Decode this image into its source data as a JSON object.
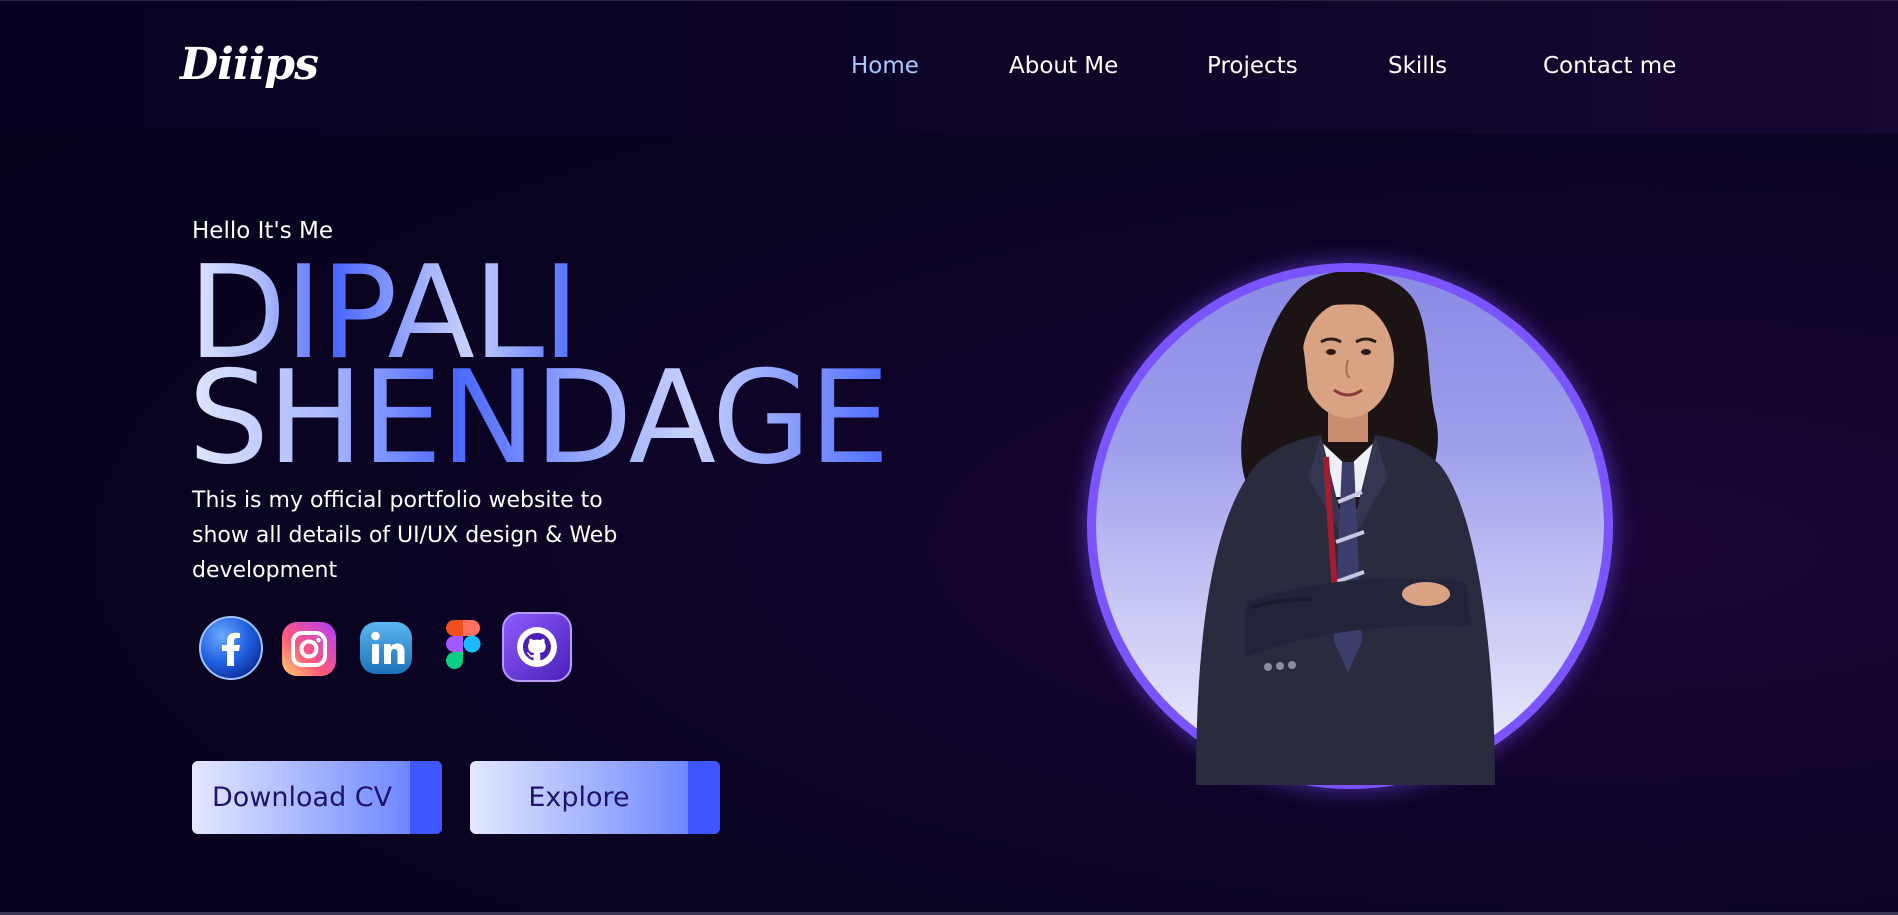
{
  "header": {
    "logo_text": "Diiips",
    "nav": [
      {
        "label": "Home",
        "active": true
      },
      {
        "label": "About Me",
        "active": false
      },
      {
        "label": "Projects",
        "active": false
      },
      {
        "label": "Skills",
        "active": false
      },
      {
        "label": "Contact me",
        "active": false
      }
    ]
  },
  "hero": {
    "greeting": "Hello It's Me",
    "name_line_1": "DIPALI",
    "name_line_2": "SHENDAGE",
    "tagline": "This is my official portfolio website to show all details of UI/UX design & Web development",
    "socials": [
      {
        "icon": "facebook-icon"
      },
      {
        "icon": "instagram-icon"
      },
      {
        "icon": "linkedin-icon"
      },
      {
        "icon": "figma-icon"
      },
      {
        "icon": "github-icon"
      }
    ],
    "buttons": {
      "download_cv": "Download CV",
      "explore": "Explore"
    }
  },
  "colors": {
    "background": "#07021a",
    "nav_active": "#a9c8ff",
    "accent": "#4a66ff",
    "ring": "#7a55ff",
    "button_text": "#1f1469"
  }
}
